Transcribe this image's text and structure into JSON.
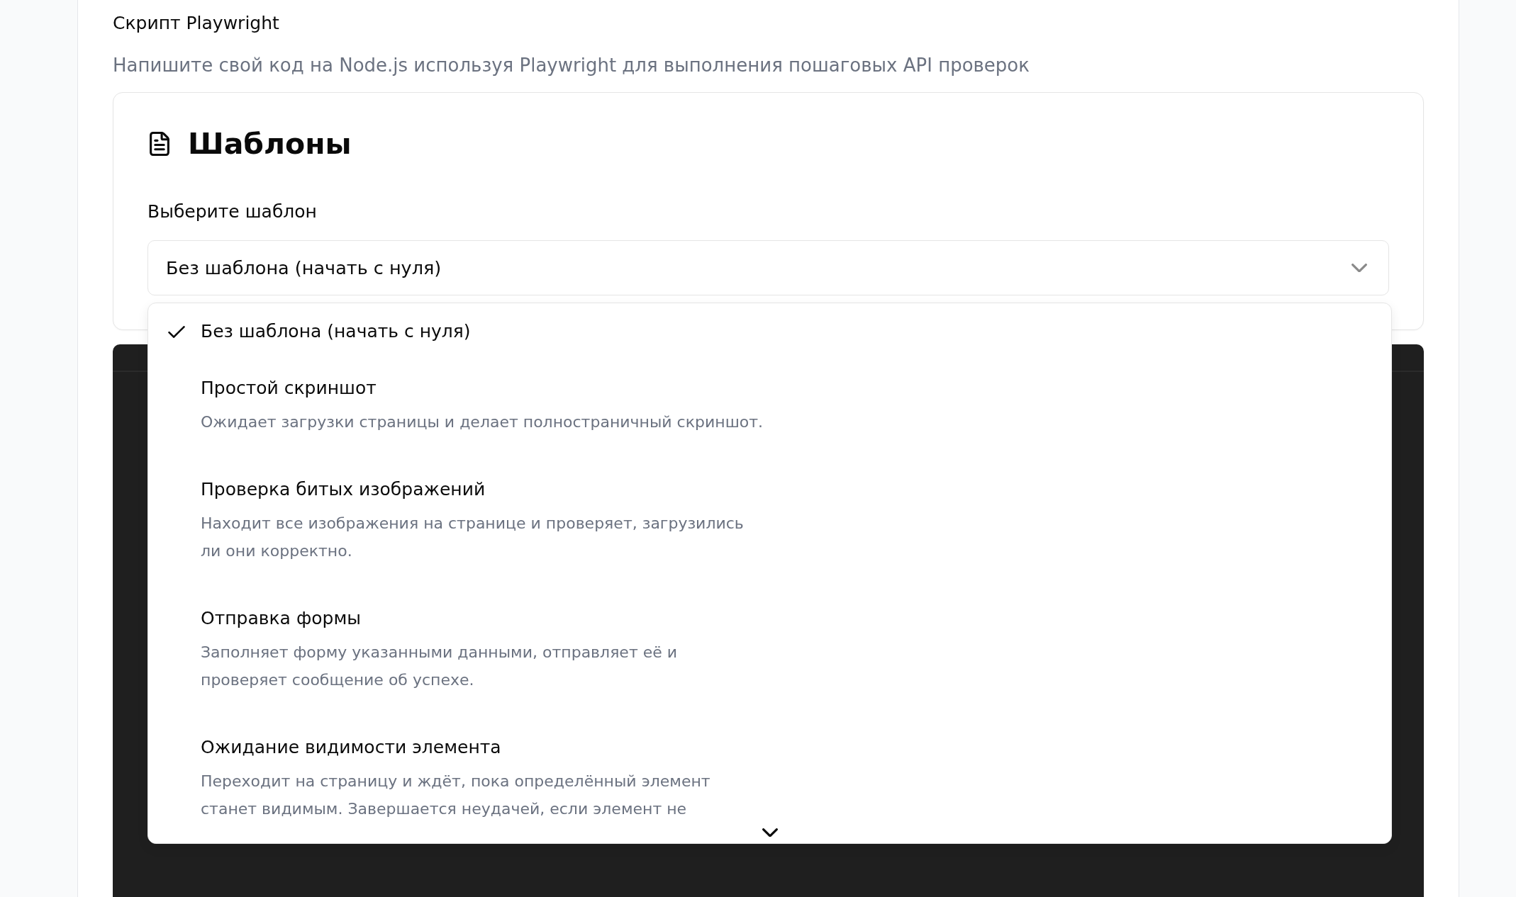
{
  "script_section": {
    "label": "Скрипт Playwright",
    "description": "Напишите свой код на Node.js используя Playwright для выполнения пошаговых API проверок"
  },
  "templates_card": {
    "title": "Шаблоны",
    "select": {
      "label": "Выберите шаблон",
      "value": "Без шаблона (начать с нуля)",
      "expanded": true,
      "options": [
        {
          "kind": "plain",
          "title": "Без шаблона (начать с нуля)",
          "selected": true
        },
        {
          "kind": "detailed",
          "title": "Простой скриншот",
          "description": "Ожидает загрузки страницы и делает полностраничный скриншот.",
          "selected": false
        },
        {
          "kind": "detailed",
          "title": "Проверка битых изображений",
          "description": "Находит все изображения на странице и проверяет, загрузились ли они корректно.",
          "selected": false
        },
        {
          "kind": "detailed",
          "title": "Отправка формы",
          "description": "Заполняет форму указанными данными, отправляет её и проверяет сообщение об успехе.",
          "selected": false
        },
        {
          "kind": "detailed",
          "title": "Ожидание видимости элемента",
          "description": "Переходит на страницу и ждёт, пока определённый элемент станет видимым. Завершается неудачей, если элемент не",
          "selected": false
        }
      ]
    }
  }
}
